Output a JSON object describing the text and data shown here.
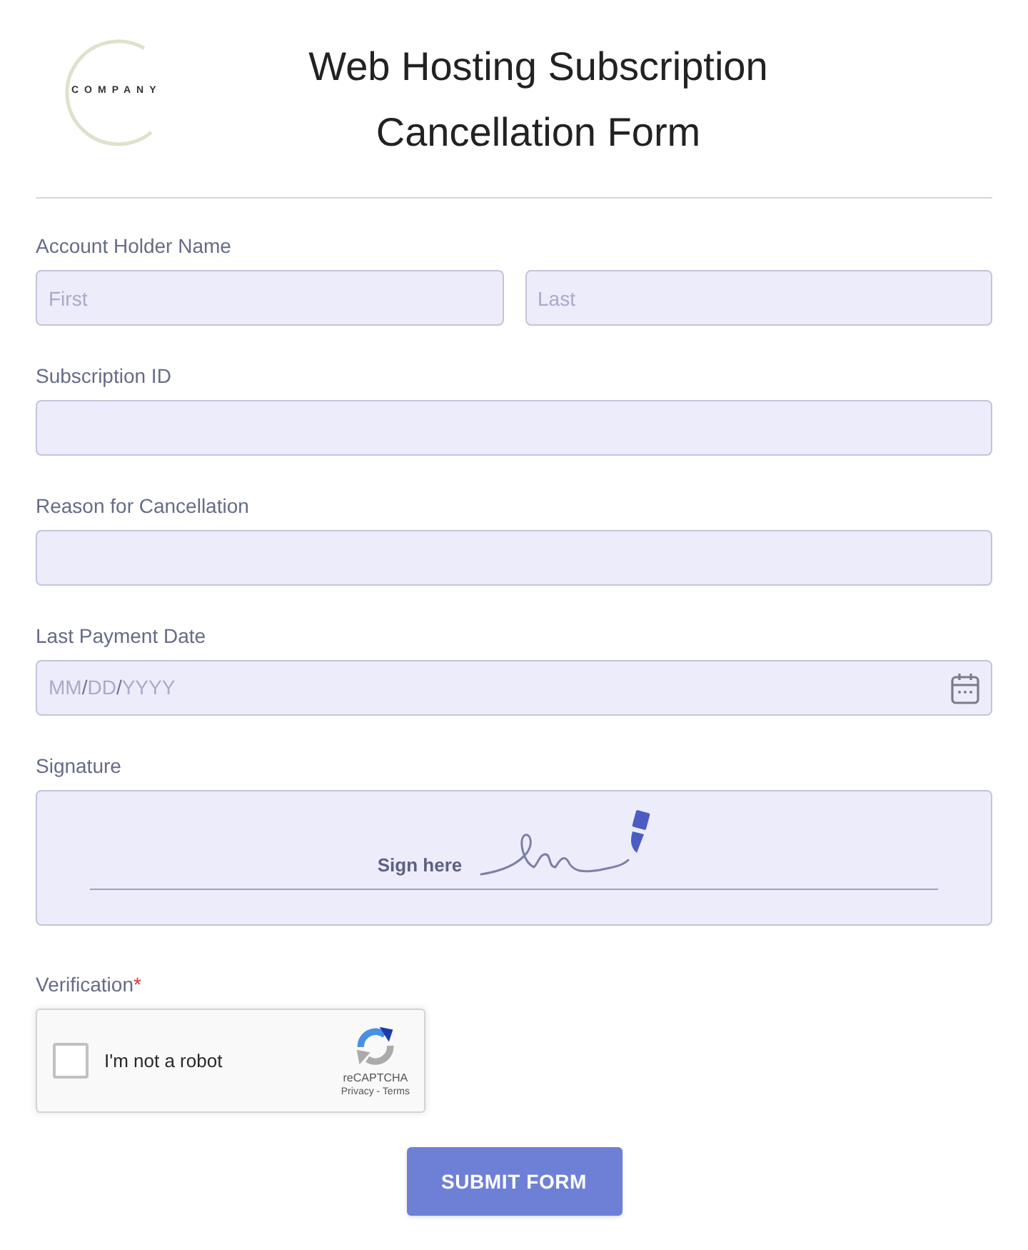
{
  "header": {
    "logo_text": "COMPANY",
    "title": "Web Hosting Subscription Cancellation Form"
  },
  "fields": [
    {
      "kind": "name",
      "label": "Account Holder Name",
      "inputs": [
        {
          "placeholder": "First"
        },
        {
          "placeholder": "Last"
        }
      ]
    },
    {
      "kind": "text",
      "label": "Subscription ID"
    },
    {
      "kind": "text",
      "label": "Reason for Cancellation"
    },
    {
      "kind": "date",
      "label": "Last Payment Date",
      "placeholder": "MM/DD/YYYY"
    },
    {
      "kind": "signature",
      "label": "Signature",
      "hint": "Sign here"
    },
    {
      "kind": "captcha",
      "label": "Verification",
      "required_mark": "*",
      "checkbox": {
        "label": "I'm not a robot",
        "checked": false
      },
      "brand": "reCAPTCHA",
      "links": "Privacy - Terms"
    }
  ],
  "submit_button": {
    "label": "SUBMIT FORM"
  }
}
